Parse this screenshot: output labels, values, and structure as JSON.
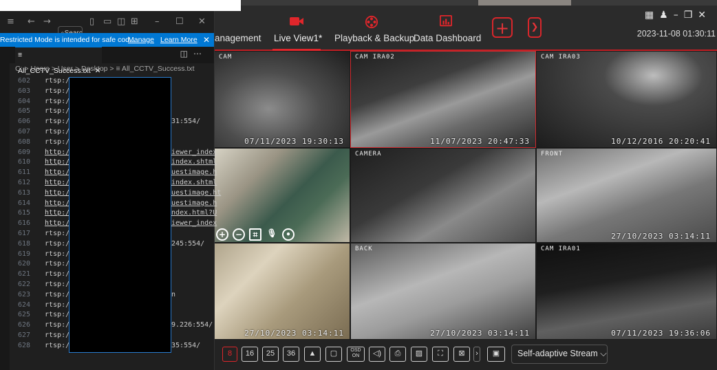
{
  "nvr": {
    "nav": {
      "management": "anagement",
      "live_view": "Live View1*",
      "playback": "Playback & Backup",
      "dashboard": "Data Dashboard"
    },
    "datetime": "2023-11-08 01:30:11",
    "window_controls": [
      "grid-icon",
      "user-icon",
      "minimize-icon",
      "restore-icon",
      "close-icon"
    ],
    "cameras": [
      {
        "caption": "CAM",
        "timestamp": "07/11/2023 19:30:13"
      },
      {
        "caption": "CAM IRA02",
        "timestamp": "11/07/2023 20:47:33"
      },
      {
        "caption": "CAM IRA03",
        "timestamp": "10/12/2016 20:20:41"
      },
      {
        "caption": "",
        "timestamp": ""
      },
      {
        "caption": "CAMERA",
        "timestamp": ""
      },
      {
        "caption": "FRONT",
        "timestamp": "27/10/2023 03:14:11"
      },
      {
        "caption": "",
        "timestamp": "27/10/2023 03:14:11"
      },
      {
        "caption": "BACK",
        "timestamp": "27/10/2023 03:14:11"
      },
      {
        "caption": "CAM IRA01",
        "timestamp": "07/11/2023 19:36:06"
      }
    ],
    "cam_controls": [
      "zoom-in-icon",
      "zoom-out-icon",
      "fit-icon",
      "mic-icon",
      "location-icon"
    ],
    "toolbar": {
      "layouts": [
        "8",
        "16",
        "25",
        "36"
      ],
      "osd_label": "OSD\nON",
      "stream": "Self-adaptive Stream"
    },
    "accent": "#e0262b"
  },
  "vscode": {
    "search": "Search",
    "restricted": {
      "message": "Restricted Mode is intended for safe cod...",
      "manage": "Manage",
      "learn_more": "Learn More"
    },
    "tab": "All_CCTV_Success.txt",
    "breadcrumb": "C: > Users > User > Desktop > ≡ All_CCTV_Success.txt",
    "lines": [
      {
        "n": "602",
        "code": "rtsp:/",
        "tail": "",
        "link": false
      },
      {
        "n": "603",
        "code": "rtsp:/",
        "tail": "",
        "link": false
      },
      {
        "n": "604",
        "code": "rtsp:/",
        "tail": "",
        "link": false
      },
      {
        "n": "605",
        "code": "rtsp:/",
        "tail": "",
        "link": false
      },
      {
        "n": "606",
        "code": "rtsp:/",
        "tail": "31:554/",
        "link": false
      },
      {
        "n": "607",
        "code": "rtsp:/",
        "tail": "",
        "link": false
      },
      {
        "n": "608",
        "code": "rtsp:/",
        "tail": "",
        "link": false
      },
      {
        "n": "609",
        "code": "http:/",
        "tail": "iewer_index",
        "link": true
      },
      {
        "n": "610",
        "code": "http:/",
        "tail": "index.shtml",
        "link": true
      },
      {
        "n": "611",
        "code": "http:/",
        "tail": "uestimage.h",
        "link": true
      },
      {
        "n": "612",
        "code": "http:/",
        "tail": "index.shtml",
        "link": true
      },
      {
        "n": "613",
        "code": "http:/",
        "tail": "uestimage.ht",
        "link": true
      },
      {
        "n": "614",
        "code": "http:/",
        "tail": "uestimage.h",
        "link": true
      },
      {
        "n": "615",
        "code": "http:/",
        "tail": "ndex.html?U",
        "link": true
      },
      {
        "n": "616",
        "code": "http:/",
        "tail": "iewer_index",
        "link": true
      },
      {
        "n": "617",
        "code": "rtsp:/",
        "tail": "",
        "link": false
      },
      {
        "n": "618",
        "code": "rtsp:/",
        "tail": "245:554/",
        "link": false
      },
      {
        "n": "619",
        "code": "rtsp:/",
        "tail": "",
        "link": false
      },
      {
        "n": "620",
        "code": "rtsp:/",
        "tail": "",
        "link": false
      },
      {
        "n": "621",
        "code": "rtsp:/",
        "tail": "",
        "link": false
      },
      {
        "n": "622",
        "code": "rtsp:/",
        "tail": "",
        "link": false
      },
      {
        "n": "623",
        "code": "rtsp:/",
        "tail": "n",
        "link": false
      },
      {
        "n": "624",
        "code": "rtsp:/",
        "tail": "",
        "link": false
      },
      {
        "n": "625",
        "code": "rtsp:/",
        "tail": "",
        "link": false
      },
      {
        "n": "626",
        "code": "rtsp:/",
        "tail": "9.226:554/",
        "link": false
      },
      {
        "n": "627",
        "code": "rtsp:/",
        "tail": "",
        "link": false
      },
      {
        "n": "628",
        "code": "rtsp:/",
        "tail": "35:554/",
        "link": false
      }
    ]
  }
}
